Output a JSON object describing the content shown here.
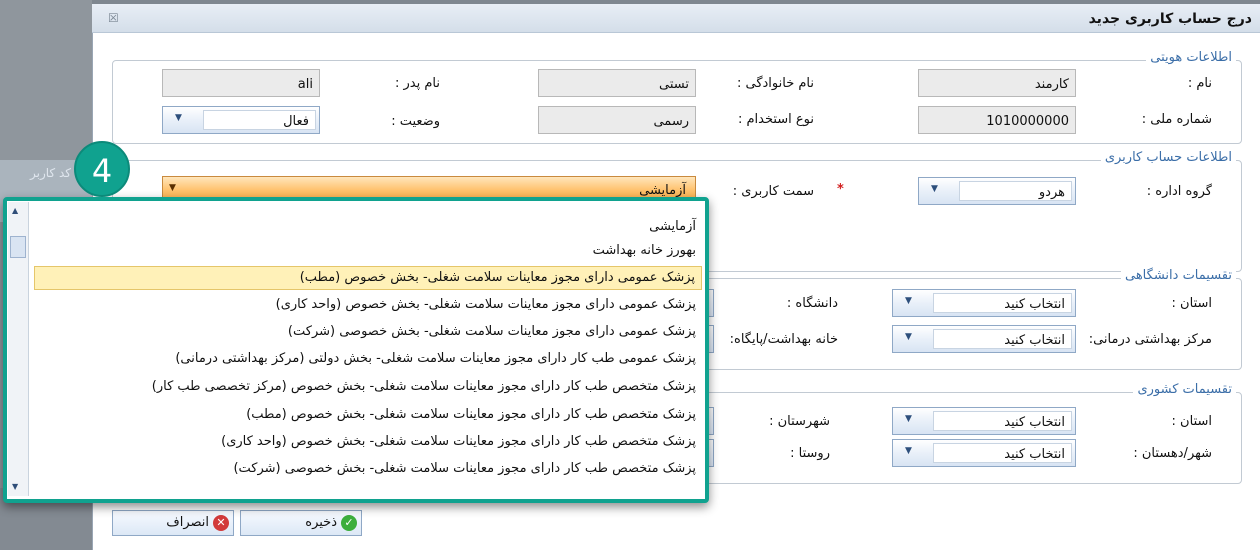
{
  "background": {
    "side_text": "کد کاربر"
  },
  "dialog": {
    "title": "درج حساب کاربری جدید",
    "close_icon": "close-icon"
  },
  "identity": {
    "legend": "اطلاعات هویتی",
    "first_name_label": "نام :",
    "first_name": "کارمند",
    "last_name_label": "نام خانوادگی :",
    "last_name": "تستی",
    "father_name_label": "نام پدر :",
    "father_name": "ali",
    "national_id_label": "شماره ملی :",
    "national_id": "1010000000",
    "employment_type_label": "نوع استخدام :",
    "employment_type": "رسمی",
    "status_label": "وضعیت :",
    "status": "فعال"
  },
  "account": {
    "legend": "اطلاعات حساب کاربری",
    "office_group_label": "گروه اداره :",
    "office_group": "هردو",
    "role_label": "سمت کاربری :",
    "role": "آزمایشی",
    "required_mark": "*"
  },
  "university": {
    "legend": "تقسیمات دانشگاهی",
    "province_label": "استان :",
    "province": "انتخاب کنید",
    "health_center_label": "مرکز بهداشتی درمانی:",
    "health_center": "انتخاب کنید",
    "university_label": "دانشگاه :",
    "health_house_label": "خانه بهداشت/پایگاه:"
  },
  "country": {
    "legend": "تقسیمات کشوری",
    "province_label": "استان :",
    "province": "انتخاب کنید",
    "city_label": "شهر/دهستان :",
    "city": "انتخاب کنید",
    "county_label": "شهرستان :",
    "village_label": "روستا :"
  },
  "buttons": {
    "save": "ذخیره",
    "cancel": "انصراف"
  },
  "dropdown": {
    "items": [
      "آزمایشی",
      "بهورز خانه بهداشت",
      "پزشک عمومی دارای مجوز معاینات سلامت شغلی- بخش خصوص (مطب)",
      "پزشک عمومی دارای مجوز معاینات سلامت شغلی- بخش خصوص (واحد کاری)",
      "پزشک عمومی دارای مجوز معاینات سلامت شغلی- بخش خصوصی (شرکت)",
      "پزشک عمومی طب کار دارای مجوز معاینات سلامت شغلی- بخش دولتی (مرکز بهداشتی درمانی)",
      "پزشک متخصص طب کار دارای مجوز معاینات سلامت شغلی- بخش خصوص (مرکز تخصصی طب کار)",
      "پزشک متخصص طب کار دارای مجوز معاینات سلامت شغلی- بخش خصوص (مطب)",
      "پزشک متخصص طب کار دارای مجوز معاینات سلامت شغلی- بخش خصوص (واحد کاری)",
      "پزشک متخصص طب کار دارای مجوز معاینات سلامت شغلی- بخش خصوصی (شرکت)"
    ],
    "selected_index": 2
  },
  "step_badge": "4"
}
